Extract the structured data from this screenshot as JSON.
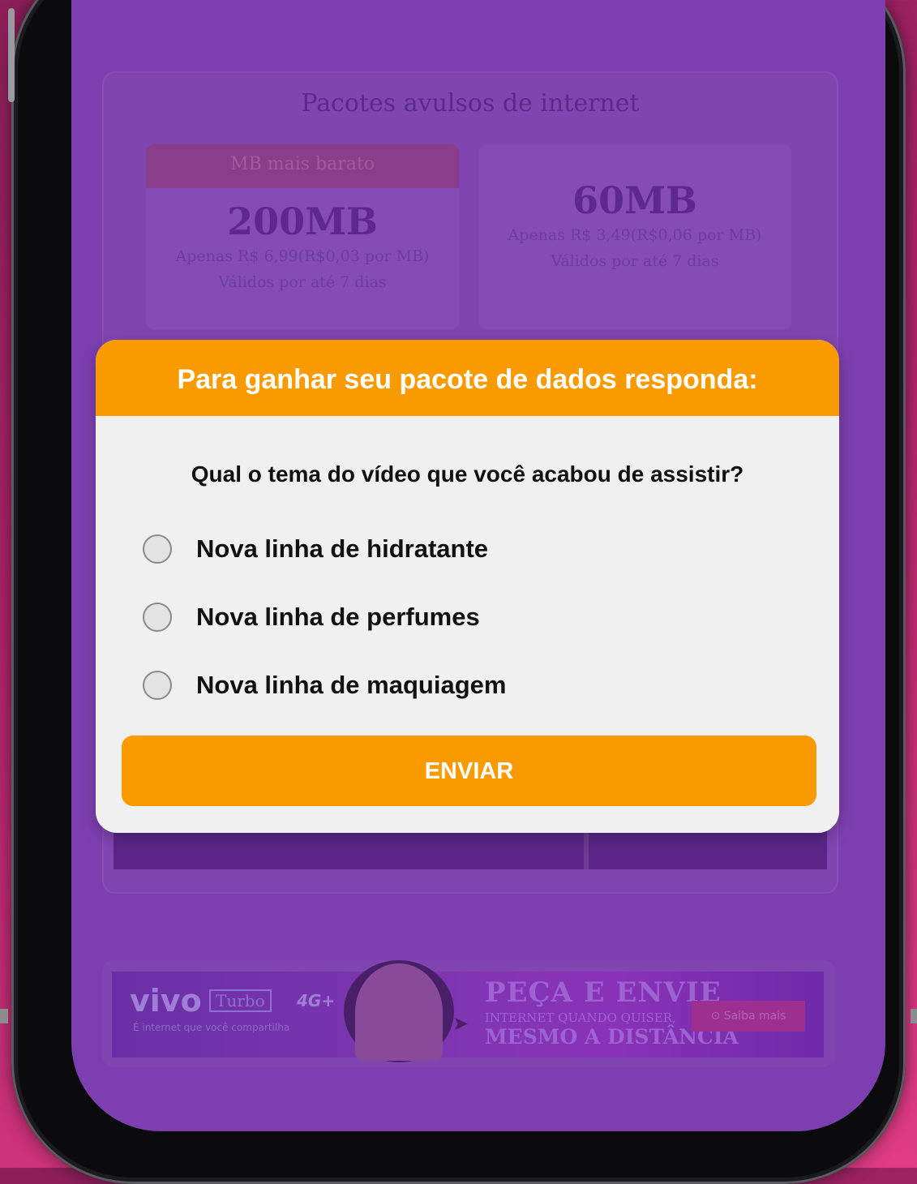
{
  "background": {
    "card_title": "Pacotes avulsos de internet",
    "packages": [
      {
        "badge": "MB mais barato",
        "size": "200MB",
        "price": "Apenas R$ 6,99(R$0,03 por MB)",
        "validity": "Válidos por até 7 dias"
      },
      {
        "badge": "",
        "size": "60MB",
        "price": "Apenas R$ 3,49(R$0,06 por MB)",
        "validity": "Válidos por até 7 dias"
      }
    ]
  },
  "ad_banner": {
    "brand": "vivo",
    "product": "Turbo",
    "network": "4G+",
    "tagline": "É internet que você compartilha",
    "headline": "PEÇA E ENVIE",
    "subline1": "INTERNET QUANDO QUISER,",
    "subline2": "MESMO A DISTÂNCIA",
    "cta": "Saiba mais"
  },
  "modal": {
    "header": "Para ganhar seu pacote de dados responda:",
    "question": "Qual o tema do vídeo que você acabou de assistir?",
    "options": [
      {
        "label": "Nova linha de hidratante",
        "selected": false
      },
      {
        "label": "Nova linha de perfumes",
        "selected": false
      },
      {
        "label": "Nova linha de maquiagem",
        "selected": false
      }
    ],
    "submit_label": "ENVIAR"
  },
  "colors": {
    "accent": "#f99b00",
    "screen_bg": "#7d3fb0",
    "modal_bg": "#f0f0f0"
  }
}
